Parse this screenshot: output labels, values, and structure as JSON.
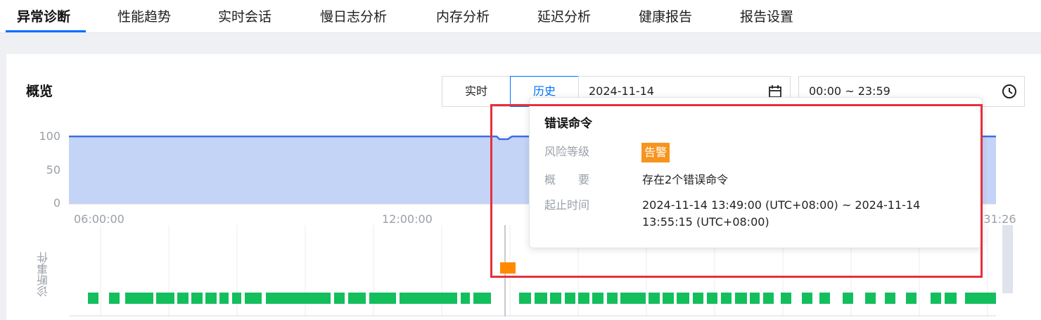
{
  "tabs": [
    {
      "label": "异常诊断",
      "active": true
    },
    {
      "label": "性能趋势"
    },
    {
      "label": "实时会话"
    },
    {
      "label": "慢日志分析"
    },
    {
      "label": "内存分析"
    },
    {
      "label": "延迟分析"
    },
    {
      "label": "健康报告"
    },
    {
      "label": "报告设置"
    }
  ],
  "overview": {
    "title": "概览",
    "mode_realtime": "实时",
    "mode_history": "历史",
    "selected_mode": "历史",
    "date": "2024-11-14",
    "time_range": "00:00 ~ 23:59",
    "calendar_icon": "calendar-icon",
    "clock_icon": "clock-icon"
  },
  "chart_data": {
    "type": "area",
    "y_ticks": [
      "100",
      "50",
      "0"
    ],
    "ylim": [
      0,
      100
    ],
    "x_ticks": [
      "06:00:00",
      "12:00:00",
      ":31:26"
    ],
    "series": [
      {
        "values": [
          100,
          100,
          100,
          96,
          96,
          100,
          100,
          100
        ],
        "color": "#3d6fe0",
        "fill": "#c4d4f7"
      }
    ],
    "event_row_label": "诊断事件",
    "event_colors": {
      "normal": "#13bf5c",
      "alarm": "#ff8a00"
    }
  },
  "tooltip": {
    "title": "错误命令",
    "risk_label": "风险等级",
    "risk_value": "告警",
    "summary_label": "概　　要",
    "summary_value": "存在2个错误命令",
    "time_label": "起止时间",
    "time_value": "2024-11-14 13:49:00 (UTC+08:00) ~ 2024-11-14 13:55:15 (UTC+08:00)"
  }
}
